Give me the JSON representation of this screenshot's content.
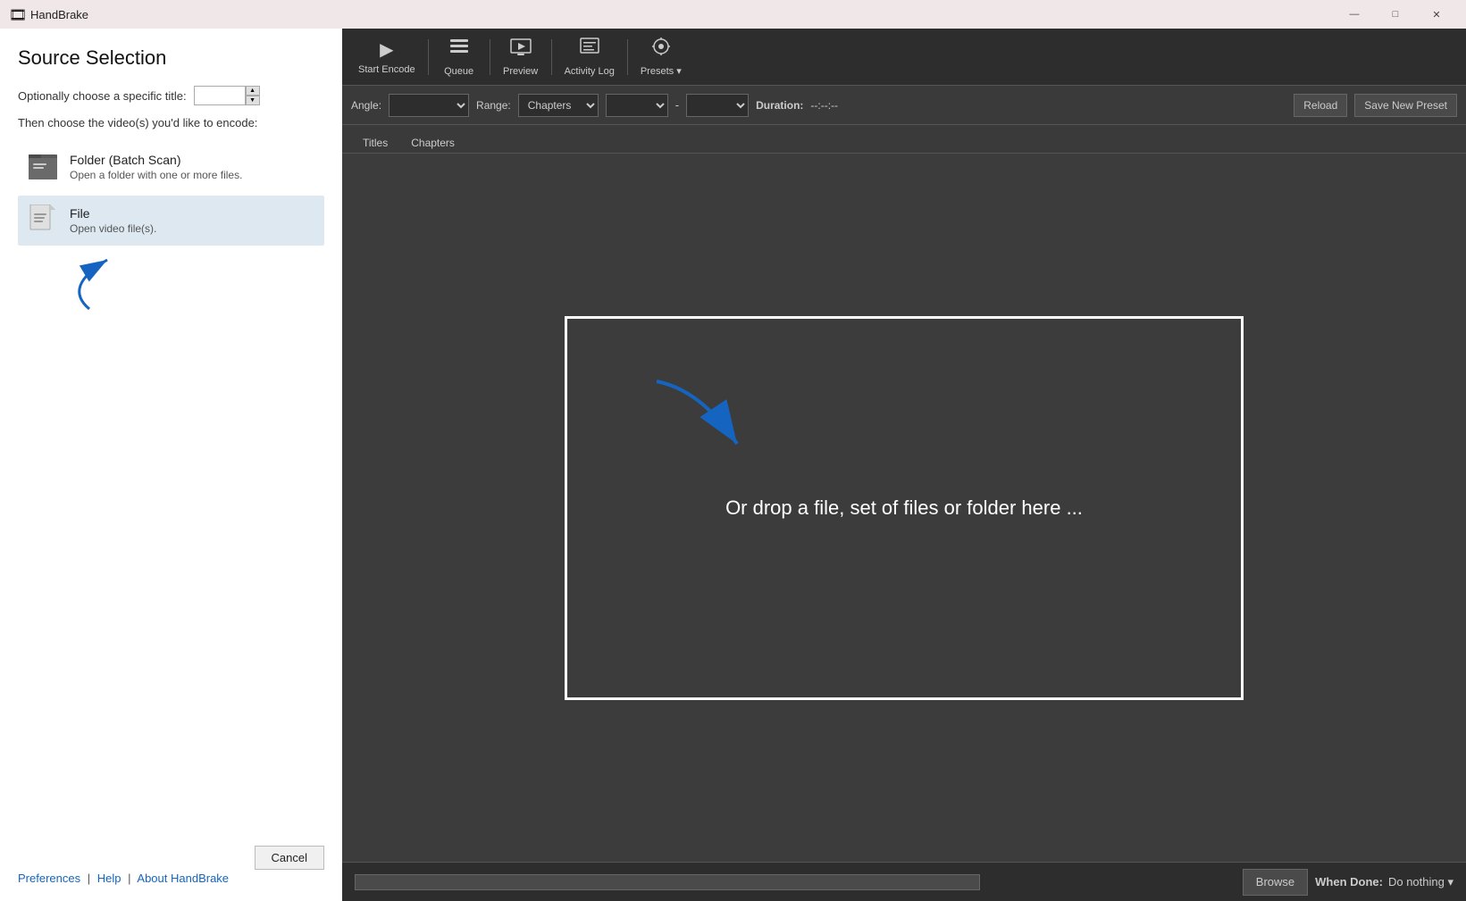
{
  "app": {
    "title": "HandBrake",
    "icon": "🎞"
  },
  "titlebar": {
    "minimize_label": "—",
    "maximize_label": "□",
    "close_label": "✕"
  },
  "source_panel": {
    "title": "Source Selection",
    "title_label": "Optionally choose a specific title:",
    "title_placeholder": "",
    "encode_label": "Then choose the video(s) you'd like to encode:",
    "options": [
      {
        "name": "Folder (Batch Scan)",
        "desc": "Open a folder with one or more files."
      },
      {
        "name": "File",
        "desc": "Open video file(s)."
      }
    ],
    "cancel_label": "Cancel",
    "footer": {
      "preferences": "Preferences",
      "sep1": "|",
      "help": "Help",
      "sep2": "|",
      "about": "About HandBrake"
    }
  },
  "toolbar": {
    "buttons": [
      {
        "id": "start-encode",
        "label": "Start Encode",
        "icon": "▶"
      },
      {
        "id": "queue",
        "label": "Queue",
        "icon": "≡"
      },
      {
        "id": "preview",
        "label": "Preview",
        "icon": "▶▶"
      },
      {
        "id": "activity-log",
        "label": "Activity Log",
        "icon": "📋"
      },
      {
        "id": "presets",
        "label": "Presets ▾",
        "icon": "⚙"
      }
    ]
  },
  "controls": {
    "angle_label": "Angle:",
    "range_label": "Range:",
    "range_value": "Chapters",
    "dash": "-",
    "duration_label": "Duration:",
    "duration_value": "--:--:--",
    "reload_label": "Reload",
    "save_preset_label": "Save New Preset"
  },
  "tabs": [
    {
      "label": "Titles"
    },
    {
      "label": "Chapters"
    }
  ],
  "drop_zone": {
    "text": "Or drop a file, set of files or folder here ..."
  },
  "status_bar": {
    "browse_label": "Browse",
    "when_done_label": "When Done:",
    "when_done_value": "Do nothing ▾"
  }
}
